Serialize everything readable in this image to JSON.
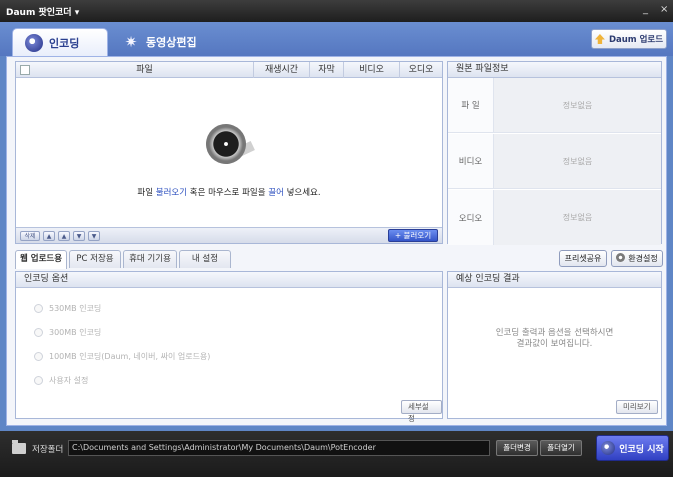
{
  "window": {
    "title": "Daum 팟인코더 ▾",
    "controls": [
      "_",
      "×"
    ]
  },
  "top_tabs": [
    {
      "label": "인코딩",
      "active": true,
      "icon": "disc-icon"
    },
    {
      "label": "동영상편집",
      "active": false,
      "icon": "sparkle-icon"
    }
  ],
  "upload_button": "Daum 업로드",
  "file_list": {
    "columns": [
      "파일",
      "재생시간",
      "자막",
      "비디오",
      "오디오"
    ],
    "drop_hint_pre": "파일 ",
    "drop_hint_link1": "불러오기",
    "drop_hint_mid": " 혹은 마우스로 파일을 ",
    "drop_hint_link2": "끌어",
    "drop_hint_post": " 넣으세요.",
    "footer_buttons": [
      "삭제",
      "▲",
      "▲",
      "▼",
      "▼"
    ],
    "load_button": "+ 불러오기"
  },
  "source_info": {
    "title": "원본 파일정보",
    "rows": [
      {
        "label": "파 일",
        "value": "정보없음"
      },
      {
        "label": "비디오",
        "value": "정보없음"
      },
      {
        "label": "오디오",
        "value": "정보없음"
      }
    ]
  },
  "sub_tabs": [
    "웹 업로드용",
    "PC 저장용",
    "휴대 기기용",
    "내 설정"
  ],
  "tool_buttons": {
    "preset_share": "프리셋공유",
    "settings": "환경설정"
  },
  "encoding_options": {
    "title": "인코딩 옵션",
    "items": [
      "530MB 인코딩",
      "300MB 인코딩",
      "100MB 인코딩(Daum, 네이버, 싸이 업로드용)",
      "사용자 설정"
    ],
    "detail_button": "세부설정"
  },
  "expected_result": {
    "title": "예상 인코딩 결과",
    "message_line1": "인코딩 출력과 옵션을 선택하시면",
    "message_line2": "결과값이 보여집니다.",
    "preview_button": "미리보기"
  },
  "bottom": {
    "save_label": "저장폴더",
    "path": "C:\\Documents and Settings\\Administrator\\My Documents\\Daum\\PotEncoder",
    "change_folder": "폴더변경",
    "open_folder": "폴더열기",
    "start_button": "인코딩 시작"
  }
}
